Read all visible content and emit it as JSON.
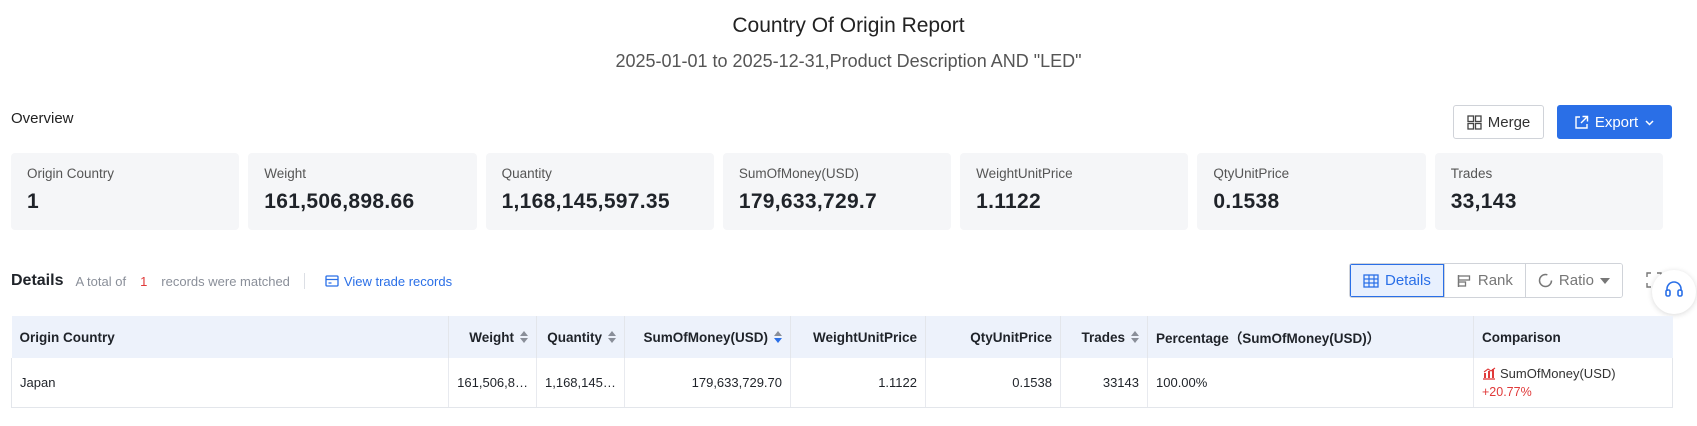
{
  "header": {
    "title": "Country Of Origin Report",
    "subtitle": "2025-01-01 to 2025-12-31,Product Description AND \"LED\""
  },
  "overview": {
    "label": "Overview",
    "merge_label": "Merge",
    "export_label": "Export",
    "stats": [
      {
        "label": "Origin Country",
        "value": "1"
      },
      {
        "label": "Weight",
        "value": "161,506,898.66"
      },
      {
        "label": "Quantity",
        "value": "1,168,145,597.35"
      },
      {
        "label": "SumOfMoney(USD)",
        "value": "179,633,729.7"
      },
      {
        "label": "WeightUnitPrice",
        "value": "1.1122"
      },
      {
        "label": "QtyUnitPrice",
        "value": "0.1538"
      },
      {
        "label": "Trades",
        "value": "33,143"
      }
    ]
  },
  "details": {
    "label": "Details",
    "total_prefix": "A total of",
    "count": "1",
    "total_suffix": "records were matched",
    "view_link": "View trade records",
    "view_tabs": [
      "Details",
      "Rank",
      "Ratio"
    ],
    "active_tab": "Details"
  },
  "table": {
    "columns": [
      "Origin Country",
      "Weight",
      "Quantity",
      "SumOfMoney(USD)",
      "WeightUnitPrice",
      "QtyUnitPrice",
      "Trades",
      "Percentage（SumOfMoney(USD)）",
      "Comparison"
    ],
    "rows": [
      {
        "country": "Japan",
        "weight": "161,506,8…",
        "quantity": "1,168,145,…",
        "sum": "179,633,729.70",
        "weight_unit_price": "1.1122",
        "qty_unit_price": "0.1538",
        "trades": "33143",
        "percentage": "100.00%",
        "comparison_metric": "SumOfMoney(USD)",
        "comparison_change": "+20.77%"
      }
    ]
  },
  "colors": {
    "accent": "#2a6fe7",
    "negative_text": "#e03a3a",
    "header_bg": "#edf2fb",
    "card_bg": "#f5f6f8"
  }
}
